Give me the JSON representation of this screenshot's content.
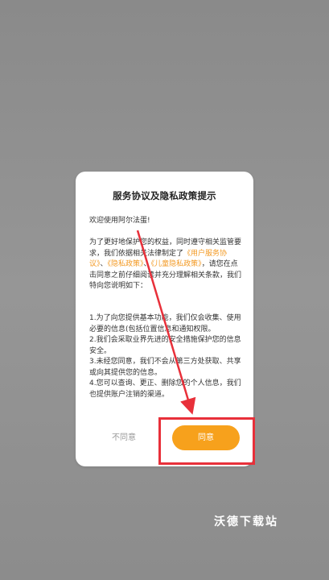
{
  "dialog": {
    "title": "服务协议及隐私政策提示",
    "greeting": "欢迎使用阿尔法蛋!",
    "intro_parts": [
      "为了更好地保护您的权益，同时遵守相关监管要求，我们依据相关法律制定了",
      "《用户服务协议》",
      "、",
      "《隐私政策》",
      "、",
      "《儿童隐私政策》",
      "，请您在点击同意之前仔细阅读并充分理解相关条款，我们特向您说明如下："
    ],
    "terms": [
      "1.为了向您提供基本功能，我们仅会收集、使用必要的信息(包括位置信息和通知权限。",
      "2.我们会采取业界先进的安全措施保护您的信息安全。",
      "3.未经您同意，我们不会从第三方处获取、共享或向其提供您的信息。",
      "4.您可以查询、更正、删除您的个人信息，我们也提供账户注销的渠道。"
    ],
    "disagree_label": "不同意",
    "agree_label": "同意"
  },
  "colors": {
    "accent": "#f7a11c",
    "link": "#f39a24",
    "annotation": "#e8303a"
  },
  "watermark": "沃德下载站"
}
